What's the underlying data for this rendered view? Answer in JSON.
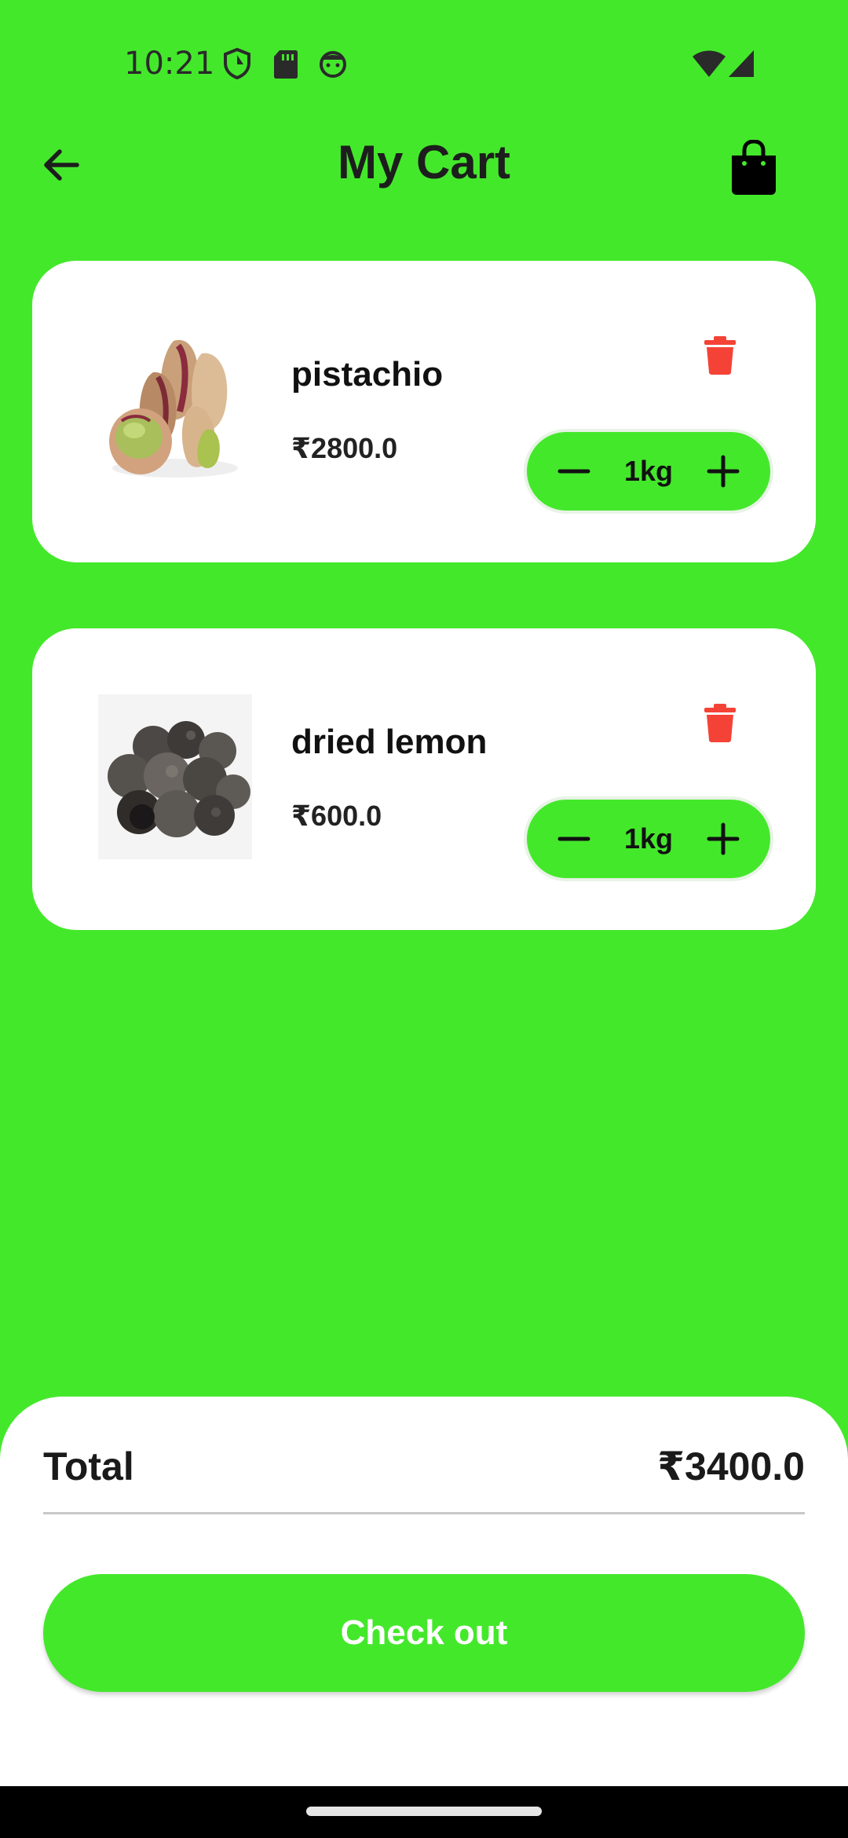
{
  "status_bar": {
    "time": "10:21",
    "icons": [
      "shield-icon",
      "sd-card-icon",
      "face-icon",
      "wifi-icon",
      "signal-icon"
    ]
  },
  "header": {
    "title": "My Cart",
    "back_icon": "arrow-left-icon",
    "bag_icon": "shopping-bag-icon"
  },
  "cart_items": [
    {
      "name": "pistachio",
      "price": "₹2800.0",
      "quantity": "1kg",
      "image": "pistachio-image"
    },
    {
      "name": "dried lemon",
      "price": "₹600.0",
      "quantity": "1kg",
      "image": "dried-lemon-image"
    }
  ],
  "summary": {
    "total_label": "Total",
    "total_value": "₹3400.0",
    "checkout_label": "Check out"
  },
  "colors": {
    "background": "#44e82b",
    "card": "#ffffff",
    "delete": "#f44336",
    "text": "#1a1a1a"
  }
}
